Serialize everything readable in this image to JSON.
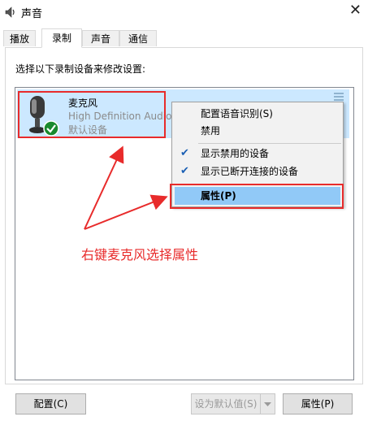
{
  "window": {
    "title": "声音",
    "close_glyph": "✕"
  },
  "tabs": [
    {
      "label": "播放",
      "active": false
    },
    {
      "label": "录制",
      "active": true
    },
    {
      "label": "声音",
      "active": false
    },
    {
      "label": "通信",
      "active": false
    }
  ],
  "instruction": "选择以下录制设备来修改设置:",
  "device": {
    "name": "麦克风",
    "driver": "High Definition Audio",
    "status": "默认设备",
    "icon": "microphone-icon",
    "badge": "default-check-icon"
  },
  "context_menu": {
    "items": [
      {
        "label": "配置语音识别(S)",
        "checked": false
      },
      {
        "label": "禁用",
        "checked": false
      },
      {
        "label": "显示禁用的设备",
        "checked": true
      },
      {
        "label": "显示已断开连接的设备",
        "checked": true
      },
      {
        "label": "属性(P)",
        "checked": false,
        "highlighted": true
      }
    ],
    "check_glyph": "✔"
  },
  "annotation": {
    "text": "右键麦克风选择属性",
    "color": "#e82b2b"
  },
  "buttons": {
    "configure": "配置(C)",
    "set_default": "设为默认值(S)",
    "properties": "属性(P)"
  },
  "colors": {
    "selection": "#cce8ff",
    "menu_highlight": "#91c9f7",
    "annotation_red": "#e82b2b",
    "check_green": "#1a8a2e"
  }
}
